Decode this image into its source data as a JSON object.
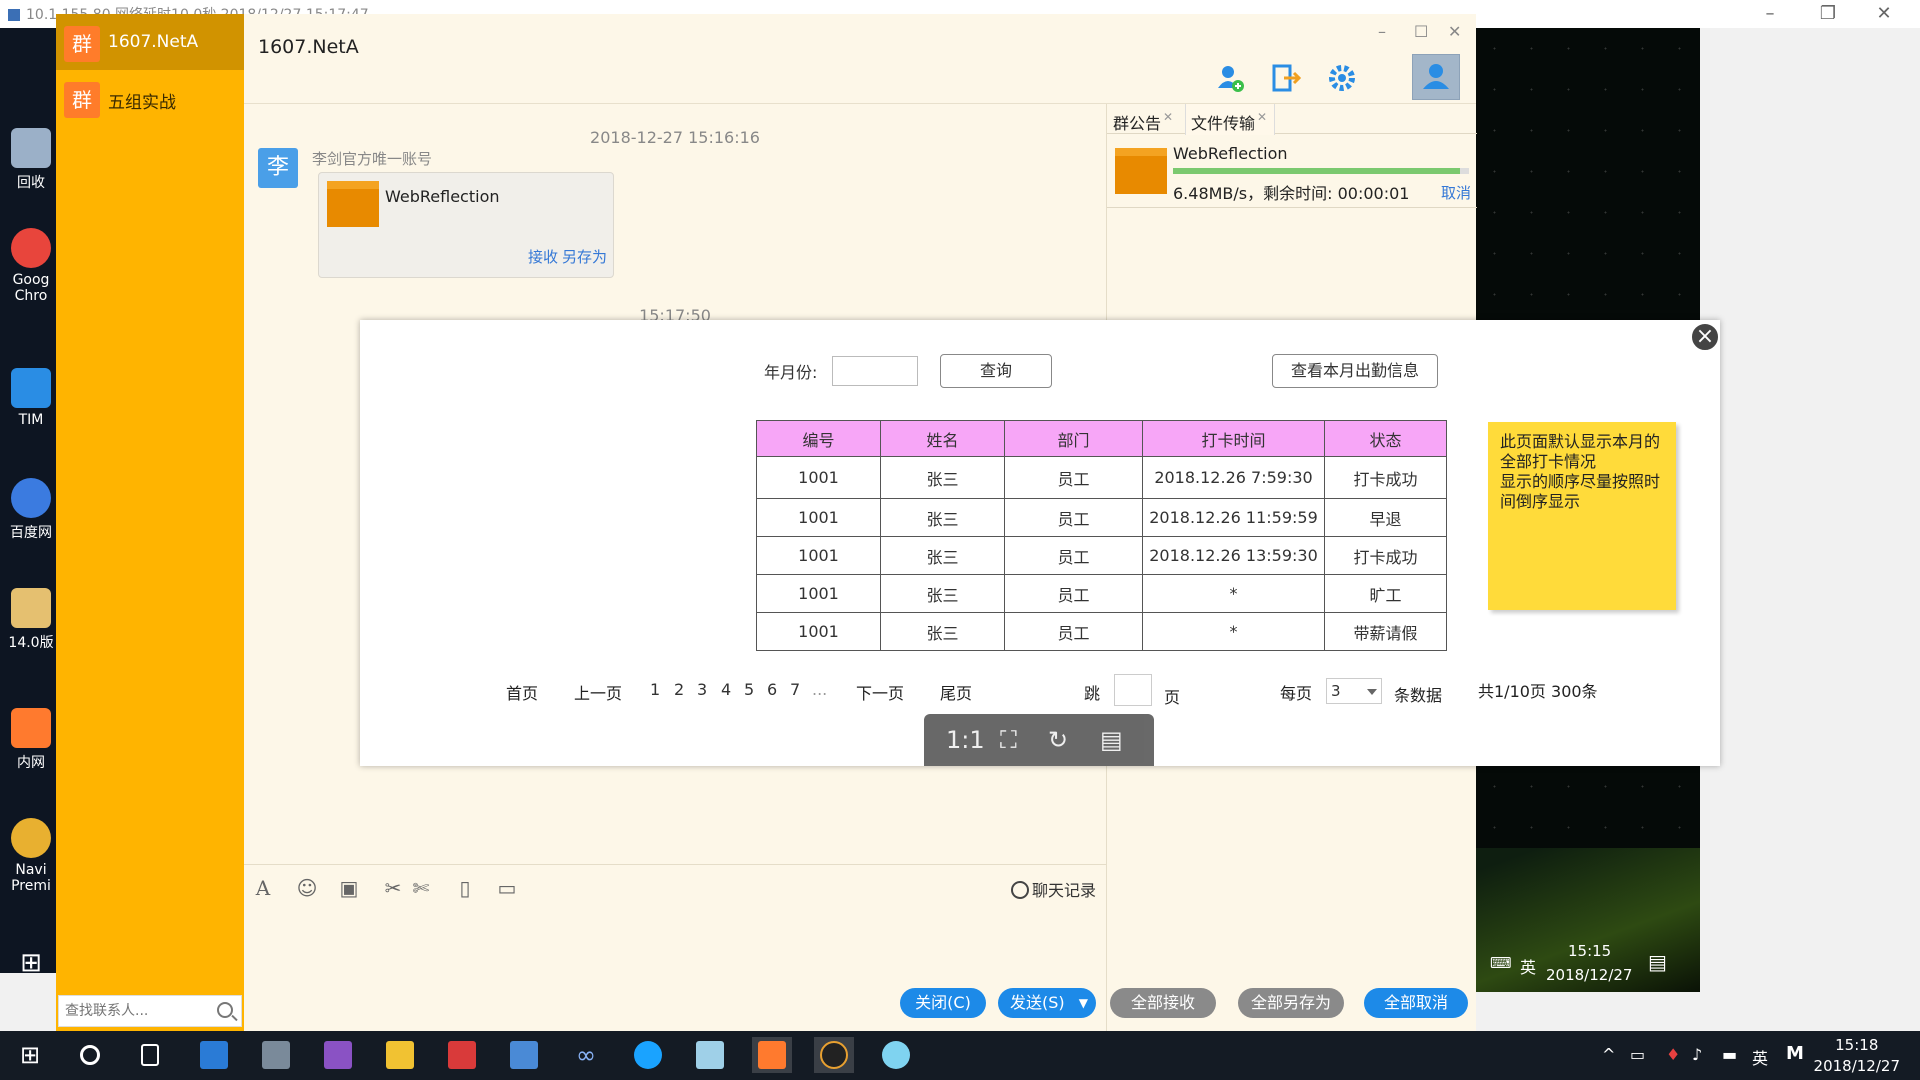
{
  "remote_bar": {
    "title": "10.1.155.80 网络延时10.0秒 2018/12/27 15:17:47"
  },
  "desktop_icons": [
    {
      "label": "回收",
      "color": "#9bb0c8"
    },
    {
      "label": "Goog Chro",
      "color": "#e8453c"
    },
    {
      "label": "TIM",
      "color": "#2a8de4"
    },
    {
      "label": "百度网",
      "color": "#3b7be0"
    },
    {
      "label": "14.0版",
      "color": "#e5c070"
    },
    {
      "label": "内网",
      "color": "#ff7a2e"
    },
    {
      "label": "Navi Premi",
      "color": "#e8b030"
    }
  ],
  "sidebar": {
    "chats": [
      {
        "badge": "群",
        "name": "1607.NetA"
      },
      {
        "badge": "群",
        "name": "五组实战"
      }
    ],
    "search_placeholder": "查找联系人..."
  },
  "chat": {
    "title": "1607.NetA",
    "timestamp1": "2018-12-27 15:16:16",
    "avatar_char": "李",
    "sender": "李剑官方唯一账号",
    "file_name": "WebReflection",
    "receive_label": "接收",
    "save_as_label": "另存为",
    "timestamp2": "15:17:50",
    "history_label": "聊天记录"
  },
  "right_panel": {
    "tabs": [
      "群公告",
      "文件传输"
    ],
    "transfer": {
      "file_name": "WebReflection",
      "progress": 0.97,
      "info": "6.48MB/s，剩余时间: 00:00:01",
      "cancel": "取消"
    }
  },
  "bottom_buttons": {
    "close": "关闭(C)",
    "send": "发送(S)",
    "accept_all": "全部接收",
    "save_all": "全部另存为",
    "cancel_all": "全部取消"
  },
  "viewer": {
    "form": {
      "label": "年月份:",
      "query": "查询",
      "view_month": "查看本月出勤信息"
    },
    "table": {
      "headers": [
        "编号",
        "姓名",
        "部门",
        "打卡时间",
        "状态"
      ],
      "rows": [
        [
          "1001",
          "张三",
          "员工",
          "2018.12.26 7:59:30",
          "打卡成功"
        ],
        [
          "1001",
          "张三",
          "员工",
          "2018.12.26 11:59:59",
          "早退"
        ],
        [
          "1001",
          "张三",
          "员工",
          "2018.12.26 13:59:30",
          "打卡成功"
        ],
        [
          "1001",
          "张三",
          "员工",
          "*",
          "旷工"
        ],
        [
          "1001",
          "张三",
          "员工",
          "*",
          "带薪请假"
        ]
      ]
    },
    "note": "此页面默认显示本月的\n全部打卡情况\n显示的顺序尽量按照时\n间倒序显示",
    "pager": {
      "first": "首页",
      "prev": "上一页",
      "pages": [
        "1",
        "2",
        "3",
        "4",
        "5",
        "6",
        "7",
        "..."
      ],
      "next": "下一页",
      "last": "尾页",
      "jump": "跳",
      "page_suffix": "页",
      "per_page_label": "每页",
      "per_page_value": "3",
      "records_label": "条数据",
      "summary": "共1/10页 300条"
    },
    "zoom_tools": [
      "1:1",
      "fit-icon",
      "rotate-icon",
      "save-icon"
    ]
  },
  "remote_tray": {
    "time": "15:15",
    "date": "2018/12/27",
    "lang": "英"
  },
  "host_taskbar": {
    "time": "15:18",
    "date": "2018/12/27",
    "lang": "英",
    "ime": "M"
  }
}
